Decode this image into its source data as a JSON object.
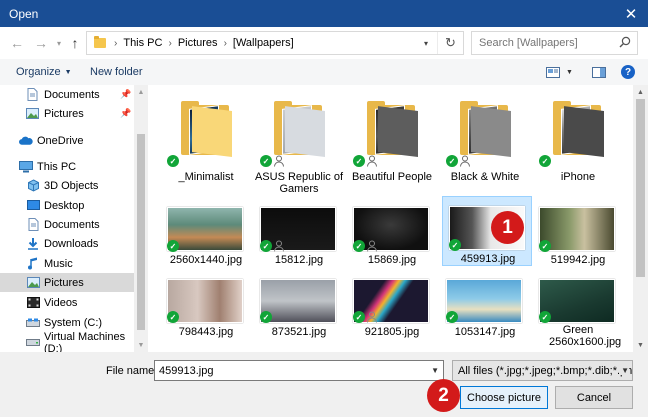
{
  "window": {
    "title": "Open",
    "close_glyph": "✕"
  },
  "address": {
    "crumbs": [
      "This PC",
      "Pictures",
      "[Wallpapers]"
    ],
    "search_placeholder": "Search [Wallpapers]"
  },
  "toolbar": {
    "organize": "Organize",
    "new_folder": "New folder",
    "help": "?"
  },
  "nav": {
    "items": [
      {
        "label": "Documents",
        "icon": "documents-icon",
        "pinned": true
      },
      {
        "label": "Pictures",
        "icon": "pictures-icon",
        "pinned": true
      },
      {
        "label": "OneDrive",
        "icon": "onedrive-icon"
      },
      {
        "label": "This PC",
        "icon": "this-pc-icon"
      },
      {
        "label": "3D Objects",
        "icon": "3d-objects-icon"
      },
      {
        "label": "Desktop",
        "icon": "desktop-icon"
      },
      {
        "label": "Documents",
        "icon": "documents-icon"
      },
      {
        "label": "Downloads",
        "icon": "downloads-icon"
      },
      {
        "label": "Music",
        "icon": "music-icon"
      },
      {
        "label": "Pictures",
        "icon": "pictures-icon",
        "selected": true
      },
      {
        "label": "Videos",
        "icon": "videos-icon"
      },
      {
        "label": "System (C:)",
        "icon": "drive-icon"
      },
      {
        "label": "Virtual Machines (D:)",
        "icon": "drive-icon"
      }
    ]
  },
  "files": {
    "folders": [
      {
        "name": "_Minimalist"
      },
      {
        "name": "ASUS Republic of Gamers"
      },
      {
        "name": "Beautiful People"
      },
      {
        "name": "Black & White"
      },
      {
        "name": "iPhone"
      }
    ],
    "images_row1": [
      {
        "name": "2560x1440.jpg"
      },
      {
        "name": "15812.jpg"
      },
      {
        "name": "15869.jpg"
      },
      {
        "name": "459913.jpg",
        "selected": true
      },
      {
        "name": "519942.jpg"
      }
    ],
    "images_row2": [
      {
        "name": "798443.jpg"
      },
      {
        "name": "873521.jpg"
      },
      {
        "name": "921805.jpg"
      },
      {
        "name": "1053147.jpg"
      },
      {
        "name": "Green 2560x1600.jpg"
      }
    ]
  },
  "bottom": {
    "filename_label": "File name:",
    "filename_value": "459913.jpg",
    "filter": "All files (*.jpg;*.jpeg;*.bmp;*.dib;*.png",
    "choose": "Choose picture",
    "cancel": "Cancel"
  },
  "badges": {
    "one": "1",
    "two": "2"
  },
  "colors": {
    "accent": "#0078d7",
    "titlebar": "#1a4e95",
    "badge": "#d31a1a",
    "sync_check": "#11a538"
  }
}
